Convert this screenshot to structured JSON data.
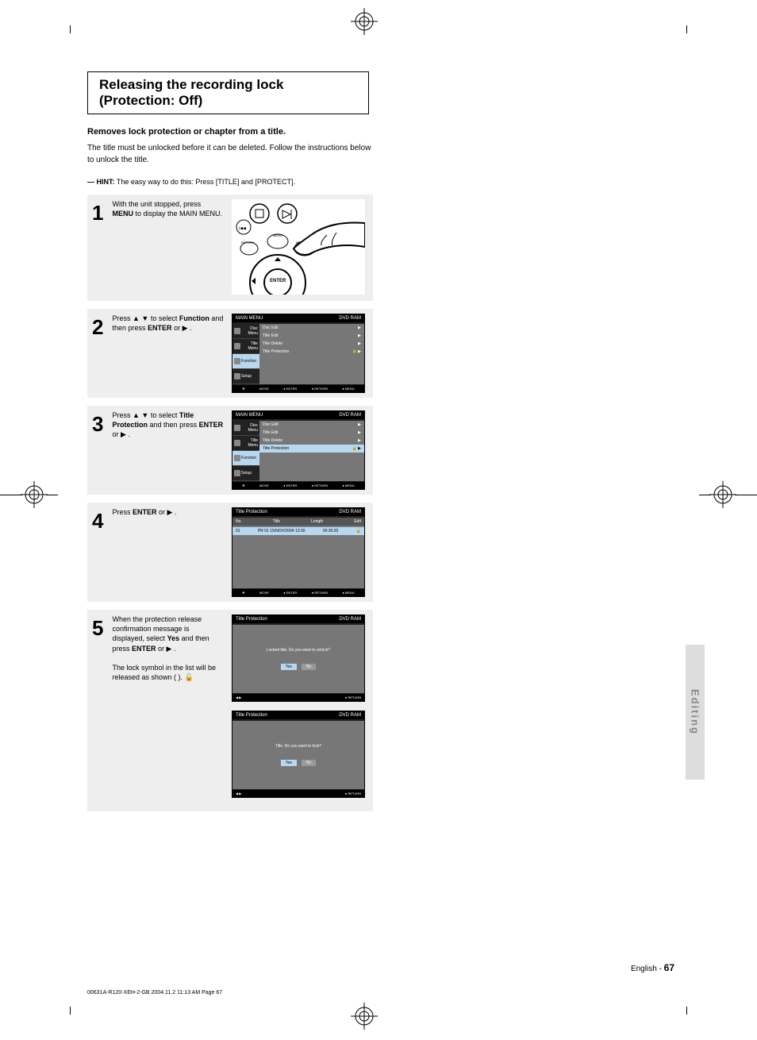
{
  "title": "Releasing the recording lock (Protection: Off)",
  "intro": {
    "lead": "Removes lock protection or chapter from a title.",
    "body": "The title must be unlocked before it can be deleted. Follow the instructions below to unlock the title."
  },
  "hint": {
    "label": "HINT:",
    "text": "The easy way to do this: Press [TITLE] and [PROTECT]."
  },
  "steps": [
    {
      "num": "1",
      "text_parts": [
        "With the unit stopped, press ",
        "MENU",
        " to display the MAIN MENU."
      ]
    },
    {
      "num": "2",
      "text_parts": [
        "Press ▲ ▼ to select ",
        "Function",
        " and then press ",
        "ENTER",
        " or ▶ ."
      ]
    },
    {
      "num": "3",
      "text_parts": [
        "Press ▲ ▼ to select ",
        "Title Protection",
        " and then press ",
        "ENTER",
        " or ▶ ."
      ]
    },
    {
      "num": "4",
      "text_parts": [
        "Press ",
        "ENTER",
        " or ▶ ."
      ]
    },
    {
      "num": "5",
      "text_parts": [
        "When the protection release confirmation message is displayed, select ",
        "Yes",
        " and then press ",
        "ENTER",
        " or ▶ ."
      ],
      "extra": "The lock symbol in the list will be released as shown (       )."
    }
  ],
  "screens": {
    "s2": {
      "titlebar_left": "MAIN MENU",
      "titlebar_right": "DVD RAM",
      "side": [
        "Disc Menu",
        "Title Menu",
        "Function",
        "Setup"
      ],
      "rows": [
        {
          "label": "Disc Edit",
          "icon": ""
        },
        {
          "label": "Title Edit",
          "icon": ""
        },
        {
          "label": "Title Delete",
          "icon": ""
        },
        {
          "label": "Title Protection",
          "icon": "🔒"
        }
      ],
      "highlight_side": 2
    },
    "s3": {
      "titlebar_left": "MAIN MENU",
      "titlebar_right": "DVD RAM",
      "side": [
        "Disc Menu",
        "Title Menu",
        "Function",
        "Setup"
      ],
      "rows": [
        {
          "label": "Disc Edit"
        },
        {
          "label": "Title Edit"
        },
        {
          "label": "Title Delete"
        },
        {
          "label": "Title Protection",
          "hl": true,
          "icon": "🔒"
        }
      ],
      "highlight_side": 2
    },
    "s4": {
      "titlebar_left": "Title Protection",
      "titlebar_right": "DVD RAM",
      "rows": [
        {
          "no": "No.",
          "title": "Title",
          "length": "Length",
          "edit": "Edit"
        },
        {
          "no": "01",
          "title": "PR 01 15/NOV/2004 13:30",
          "length": "00:30:20",
          "edit": "🔒",
          "hl": true
        }
      ]
    },
    "s5a": {
      "titlebar_left": "Title Protection",
      "titlebar_right": "DVD RAM",
      "message": "Locked title.\nDo you want to unlock?",
      "yes": "Yes",
      "no": "No",
      "footer_left": "◀ ▶",
      "footer_right": "● RETURN"
    },
    "s5b": {
      "titlebar_left": "Title Protection",
      "titlebar_right": "DVD RAM",
      "message": "Title.\nDo you want to lock?",
      "yes": "Yes",
      "no": "No",
      "footer_left": "◀ ▶",
      "footer_right": "● RETURN"
    },
    "footer_nav": [
      "MOVE",
      "● ENTER",
      "● RETURN",
      "● MENU"
    ]
  },
  "side_tab": "Editing",
  "page": {
    "label": "English -",
    "num": "67"
  },
  "file_footer": "00631A-R120-XEH-2-GB  2004.11.2  11:13 AM  Page 67"
}
